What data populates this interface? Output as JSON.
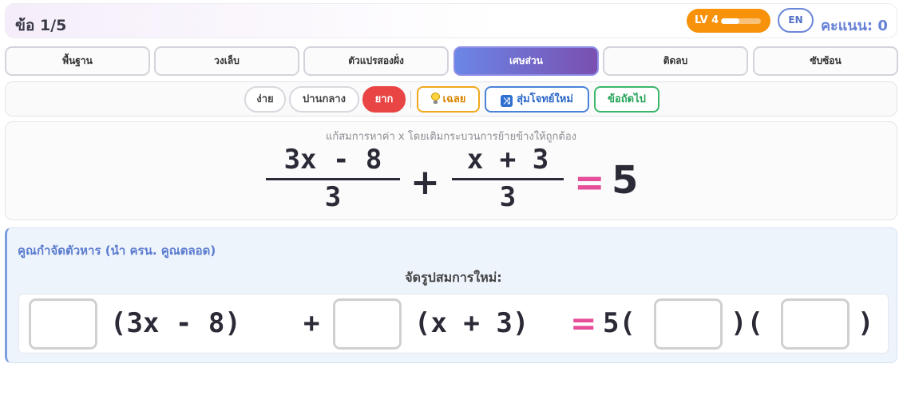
{
  "header": {
    "question_counter": "ข้อ 1/5",
    "level_label": "LV 4",
    "level_progress": 0.45,
    "lang_button": "EN",
    "score_label": "คะแนน: 0"
  },
  "tabs": [
    {
      "label": "พื้นฐาน",
      "active": false
    },
    {
      "label": "วงเล็บ",
      "active": false
    },
    {
      "label": "ตัวแปรสองฝั่ง",
      "active": false
    },
    {
      "label": "เศษส่วน",
      "active": true
    },
    {
      "label": "ติดลบ",
      "active": false
    },
    {
      "label": "ซับซ้อน",
      "active": false
    }
  ],
  "controls": {
    "difficulty": [
      {
        "label": "ง่าย",
        "active": false
      },
      {
        "label": "ปานกลาง",
        "active": false
      },
      {
        "label": "ยาก",
        "active": true
      }
    ],
    "hint_label": "เฉลย",
    "random_label": "สุ่มโจทย์ใหม่",
    "skip_label": "ข้อถัดไป"
  },
  "problem": {
    "instruction": "แก้สมการหาค่า x โดยเติมกระบวนการย้ายข้างให้ถูกต้อง",
    "frac1_num": "3x - 8",
    "frac1_den": "3",
    "plus": "+",
    "frac2_num": "x + 3",
    "frac2_den": "3",
    "equals": "=",
    "rhs": "5"
  },
  "step": {
    "title": "คูณกำจัดตัวหาร (นำ ครน. คูณตลอด)",
    "reshape_label": "จัดรูปสมการใหม่:",
    "seg1": "(3x - 8)",
    "plus": "+",
    "seg2": "(x + 3)",
    "equals": "=",
    "rhs_prefix": "5(",
    "mid": ")(",
    "close": ")"
  },
  "colors": {
    "accent_orange": "#f7920a",
    "active_tab_gradient_start": "#6b86e6",
    "active_tab_gradient_end": "#7a4fb0",
    "hard_red": "#e94545",
    "equals_pink": "#e64e9a",
    "score_blue": "#6782d6"
  }
}
